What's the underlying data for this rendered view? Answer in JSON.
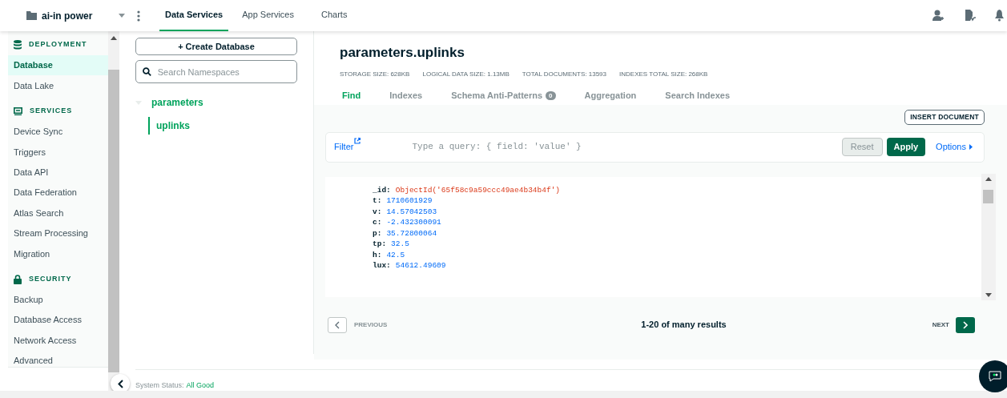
{
  "top_bar": {
    "project": "ai-in power",
    "tabs": [
      {
        "label": "Data Services",
        "selected": true
      },
      {
        "label": "App Services",
        "selected": false
      },
      {
        "label": "Charts",
        "selected": false
      }
    ]
  },
  "sidebar": {
    "sections": [
      {
        "title": "DEPLOYMENT",
        "kind": "database",
        "items": [
          {
            "label": "Database",
            "selected": true
          },
          {
            "label": "Data Lake",
            "selected": false
          }
        ]
      },
      {
        "title": "SERVICES",
        "kind": "screen",
        "items": [
          {
            "label": "Device Sync",
            "selected": false
          },
          {
            "label": "Triggers",
            "selected": false
          },
          {
            "label": "Data API",
            "selected": false
          },
          {
            "label": "Data Federation",
            "selected": false
          },
          {
            "label": "Atlas Search",
            "selected": false
          },
          {
            "label": "Stream Processing",
            "selected": false
          },
          {
            "label": "Migration",
            "selected": false
          }
        ]
      },
      {
        "title": "SECURITY",
        "kind": "lock",
        "items": [
          {
            "label": "Backup",
            "selected": false
          },
          {
            "label": "Database Access",
            "selected": false
          },
          {
            "label": "Network Access",
            "selected": false
          },
          {
            "label": "Advanced",
            "selected": false
          }
        ]
      }
    ]
  },
  "namespaces": {
    "create_button": "+ Create Database",
    "search": {
      "placeholder": "Search Namespaces"
    },
    "tree": [
      {
        "label": "parameters",
        "expanded": true,
        "children": [
          {
            "label": "uplinks",
            "selected": true
          }
        ]
      }
    ]
  },
  "collection": {
    "title": "parameters.uplinks",
    "stats": [
      "STORAGE SIZE: 628KB",
      "LOGICAL DATA SIZE: 1.13MB",
      "TOTAL DOCUMENTS: 13593",
      "INDEXES TOTAL SIZE: 268KB"
    ],
    "tabs": [
      {
        "label": "Find",
        "selected": true
      },
      {
        "label": "Indexes",
        "selected": false
      },
      {
        "label": "Schema Anti-Patterns",
        "badge": "0",
        "selected": false
      },
      {
        "label": "Aggregation",
        "selected": false
      },
      {
        "label": "Search Indexes",
        "selected": false
      }
    ],
    "insert_button": "INSERT DOCUMENT",
    "filter": {
      "label": "Filter",
      "placeholder": "Type a query: { field: 'value' }"
    },
    "reset_button": {
      "label": "Reset",
      "disabled": true
    },
    "apply_button": "Apply",
    "options_link": "Options",
    "document": [
      {
        "key": "_id:",
        "value": "ObjectId('65f58c9a59ccc49ae4b34b4f')",
        "kind": "objectid"
      },
      {
        "key": "t:",
        "value": "1710601929",
        "kind": "number"
      },
      {
        "key": "v:",
        "value": "14.57042503",
        "kind": "number"
      },
      {
        "key": "c:",
        "value": "-2.432300091",
        "kind": "number"
      },
      {
        "key": "p:",
        "value": "35.72800064",
        "kind": "number"
      },
      {
        "key": "tp:",
        "value": "32.5",
        "kind": "number"
      },
      {
        "key": "h:",
        "value": "42.5",
        "kind": "number"
      },
      {
        "key": "lux:",
        "value": "54612.49609",
        "kind": "number"
      }
    ],
    "pagination": {
      "previous": {
        "label": "PREVIOUS",
        "disabled": true
      },
      "summary": "1-20 of many results",
      "next": {
        "label": "NEXT",
        "disabled": false
      }
    }
  },
  "status": {
    "label": "System Status:",
    "value": "All Good"
  }
}
